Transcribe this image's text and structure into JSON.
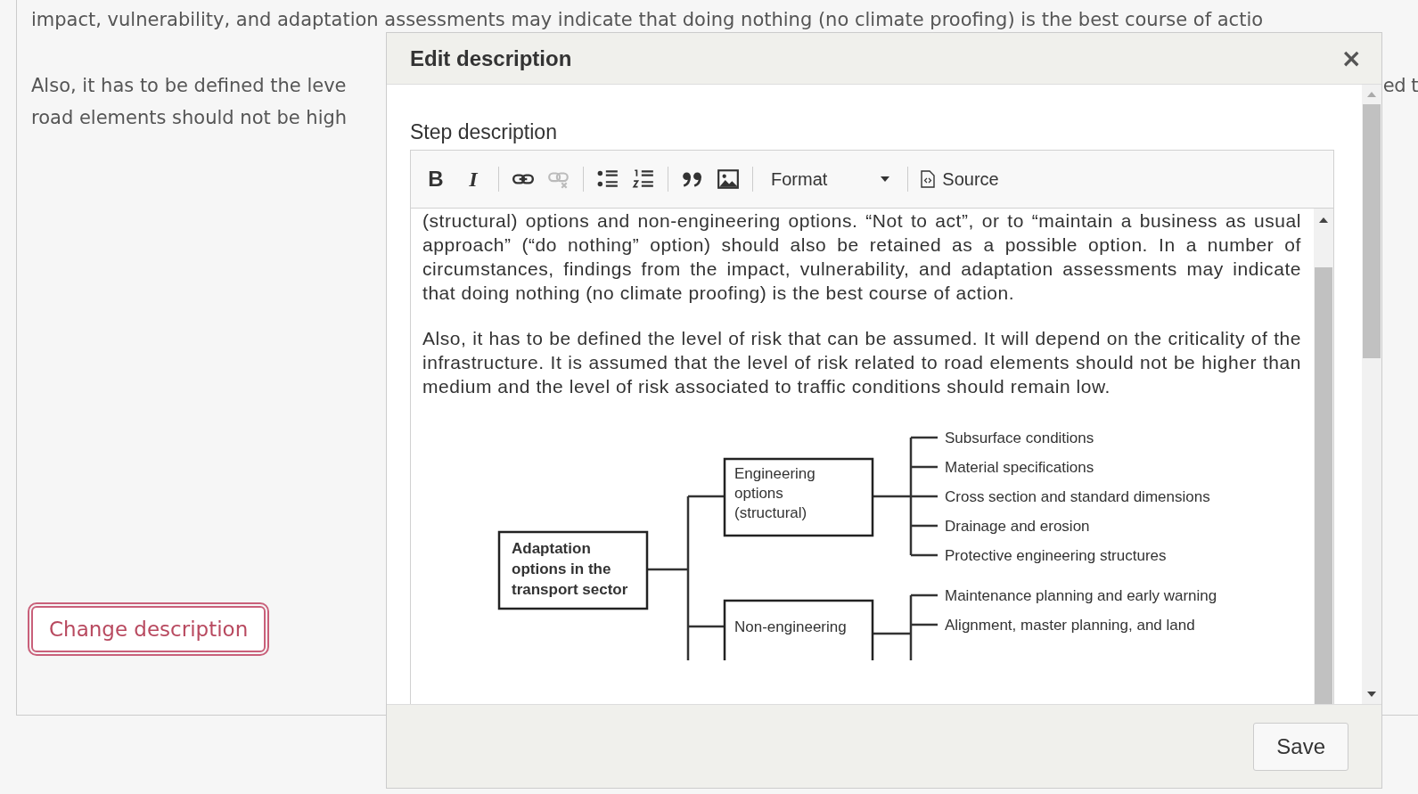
{
  "page": {
    "top_line": "impact, vulnerability, and adaptation assessments may indicate that doing nothing (no climate proofing) is the best course of actio",
    "left_lines": [
      "Also, it has to be defined the leve",
      "road elements should not be high"
    ],
    "right_fragment": "ed t",
    "button": "Change description"
  },
  "modal": {
    "title": "Edit description",
    "close": "×",
    "field_label": "Step description",
    "toolbar": [
      [
        {
          "kind": "bold",
          "glyph": "B",
          "disabled": false
        },
        {
          "kind": "italic",
          "glyph": "I",
          "disabled": false
        }
      ],
      [
        {
          "kind": "link",
          "disabled": false
        },
        {
          "kind": "unlink",
          "disabled": true
        }
      ],
      [
        {
          "kind": "bulleted-list",
          "disabled": false
        },
        {
          "kind": "numbered-list",
          "disabled": false
        }
      ],
      [
        {
          "kind": "blockquote",
          "disabled": false
        },
        {
          "kind": "image",
          "disabled": false
        }
      ],
      [
        {
          "kind": "dropdown",
          "label": "Format",
          "disabled": false
        }
      ],
      [
        {
          "kind": "source",
          "label": "Source",
          "disabled": false
        }
      ]
    ],
    "paragraphs": [
      "(structural) options and non-engineering options. “Not to act”, or to “maintain a business as usual approach” (“do nothing” option) should also be retained as a possible option. In a number of circumstances, findings from the impact, vulnerability, and adaptation assessments may indicate that doing nothing (no climate proofing) is the best course of action.",
      "Also, it has to be defined the level of risk that can be assumed. It will depend on the criticality of the infrastructure. It is assumed that the level of risk related to road elements should not be higher than medium and the level of risk associated to traffic conditions should remain low."
    ],
    "diagram": {
      "root": [
        "Adaptation",
        "options in the",
        "transport sector"
      ],
      "branches": [
        {
          "lines": [
            "Engineering",
            "options",
            "(structural)"
          ],
          "items": [
            "Subsurface conditions",
            "Material specifications",
            "Cross section and standard dimensions",
            "Drainage and erosion",
            "Protective engineering structures"
          ]
        },
        {
          "lines": [
            "Non-engineering"
          ],
          "items": [
            "Maintenance planning and early warning",
            "Alignment, master planning, and land"
          ]
        }
      ]
    },
    "save": "Save"
  }
}
